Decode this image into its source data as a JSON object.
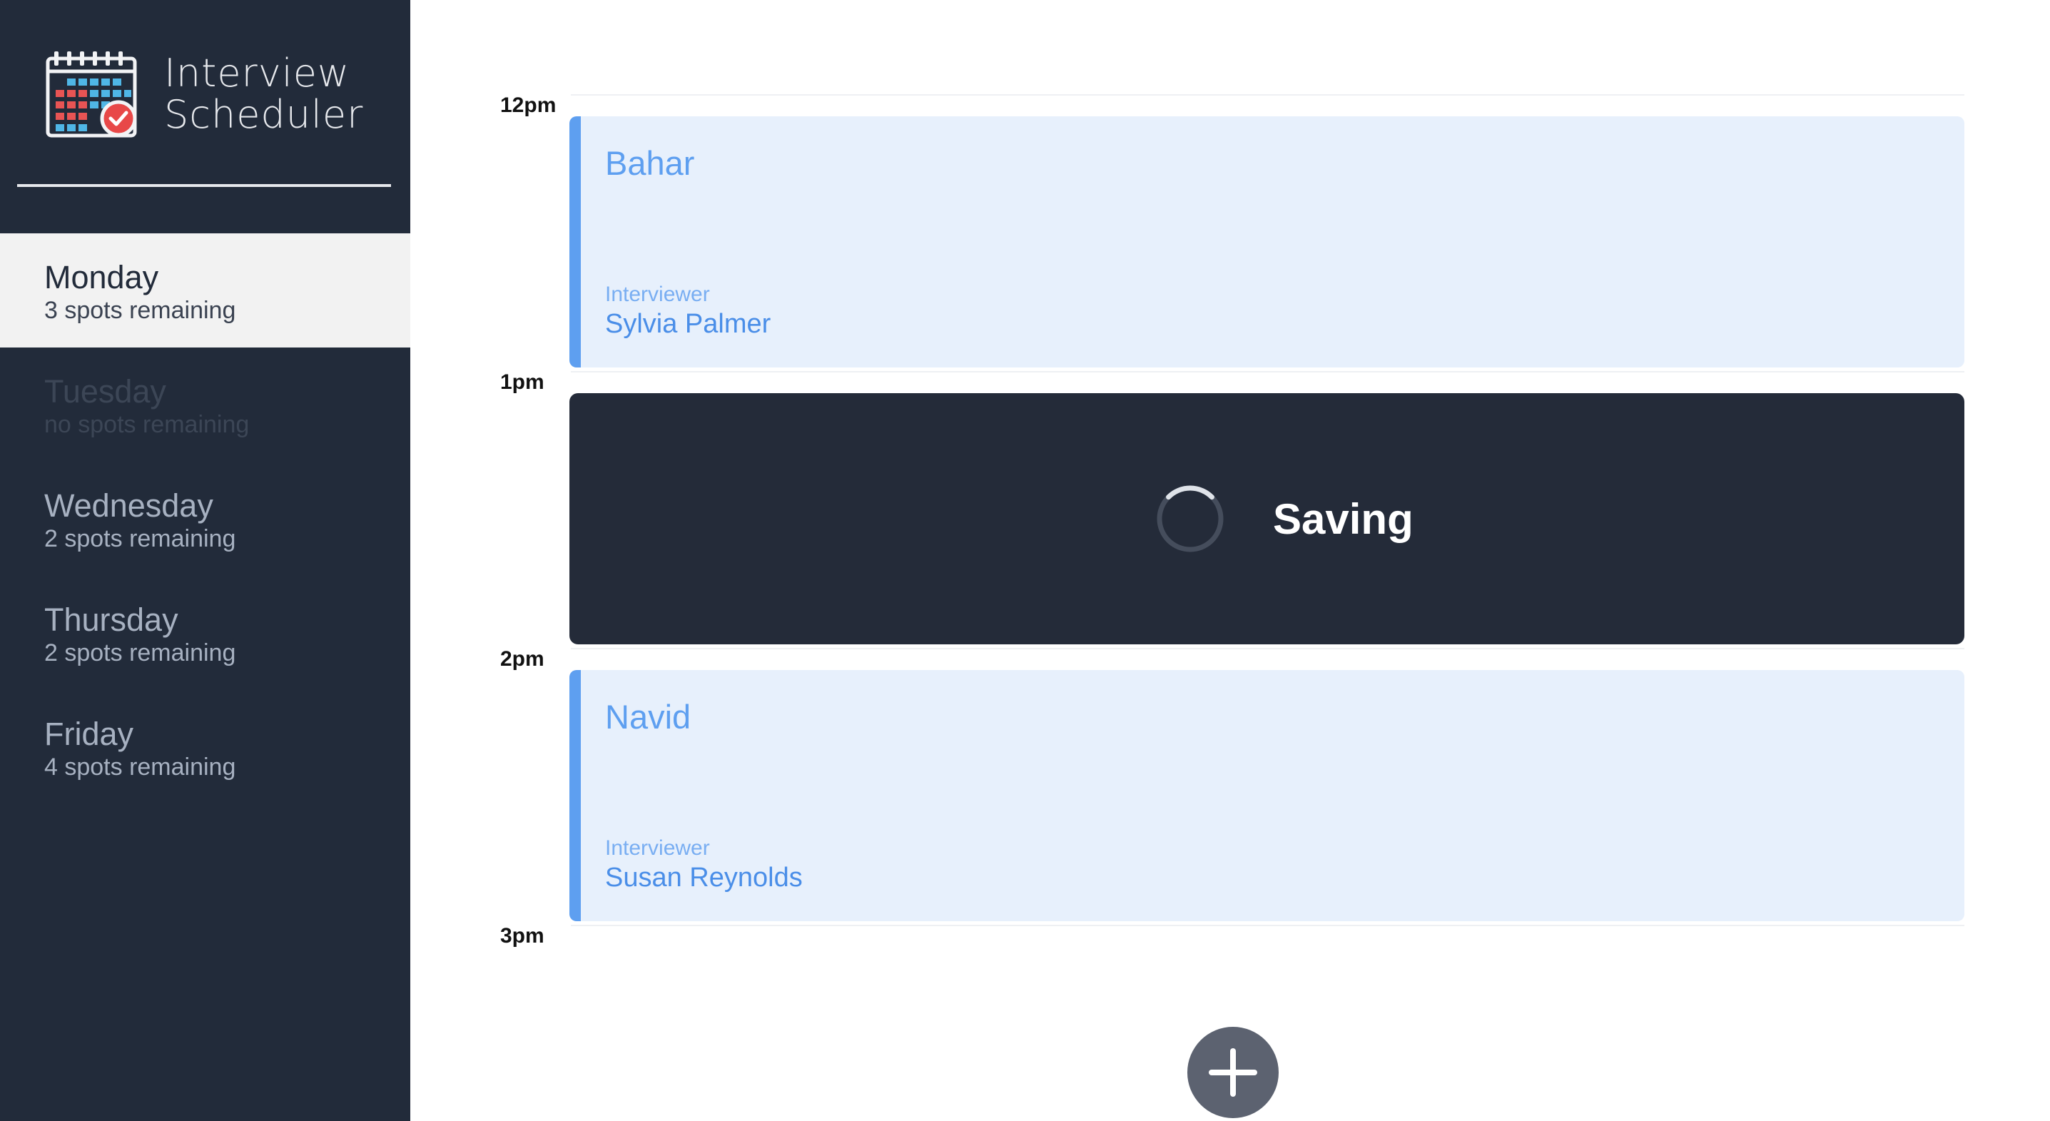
{
  "app": {
    "title_line1": "Interview",
    "title_line2": "Scheduler"
  },
  "sidebar": {
    "days": [
      {
        "name": "Monday",
        "spots": "3 spots remaining",
        "selected": true
      },
      {
        "name": "Tuesday",
        "spots": "no spots remaining",
        "full": true
      },
      {
        "name": "Wednesday",
        "spots": "2 spots remaining"
      },
      {
        "name": "Thursday",
        "spots": "2 spots remaining"
      },
      {
        "name": "Friday",
        "spots": "4 spots remaining"
      }
    ]
  },
  "schedule": {
    "times": [
      "12pm",
      "1pm",
      "2pm",
      "3pm"
    ],
    "appointments": [
      {
        "student": "Bahar",
        "interviewer_label": "Interviewer",
        "interviewer": "Sylvia Palmer"
      },
      {
        "status": "Saving"
      },
      {
        "student": "Navid",
        "interviewer_label": "Interviewer",
        "interviewer": "Susan Reynolds"
      }
    ]
  },
  "colors": {
    "sidebar_bg": "#222b3a",
    "accent": "#5e9ff0",
    "appointment_bg": "#e7f0fc",
    "saving_bg": "#242b39",
    "add_button": "#5c6270"
  },
  "icons": {
    "logo": "calendar-check-icon",
    "spinner": "spinner-icon",
    "add": "plus-icon"
  }
}
